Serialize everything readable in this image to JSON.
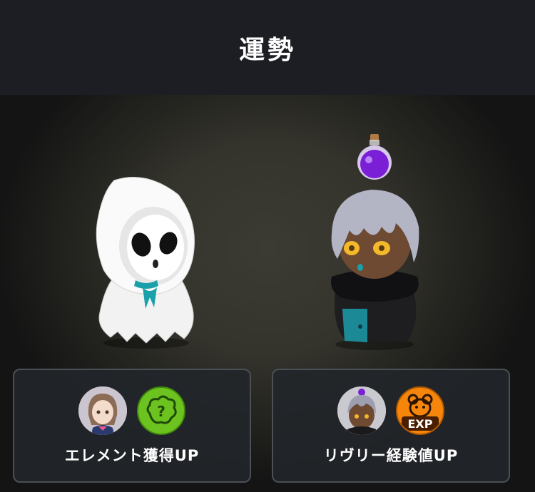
{
  "header": {
    "title": "運勢"
  },
  "cards": [
    {
      "label": "エレメント獲得UP"
    },
    {
      "label": "リヴリー経験値UP",
      "exp_badge": "EXP"
    }
  ],
  "icons": {
    "ghost": "ghost-character",
    "potion": "potion-bottle-icon",
    "boy": "grey-haired-character",
    "element": "element-question-icon",
    "exp": "exp-bear-icon"
  },
  "colors": {
    "element_green": "#6cc21f",
    "exp_orange": "#f5860b",
    "potion_purple": "#8a2be2",
    "scarf_teal": "#1a8f9c"
  }
}
